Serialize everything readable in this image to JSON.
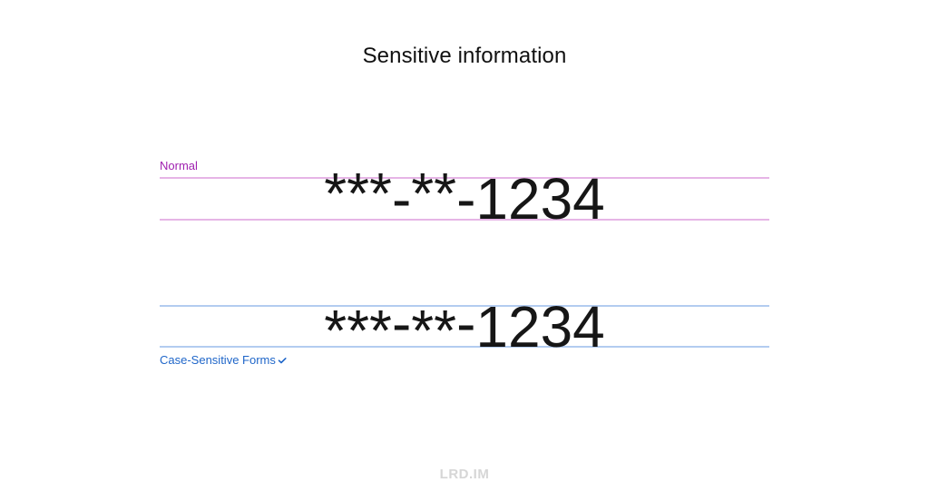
{
  "title": "Sensitive information",
  "rows": [
    {
      "label": "Normal",
      "color": "#a020b0",
      "guide_color": "#e6b5e6",
      "mask": "***",
      "sep1": "-",
      "mask2": "**",
      "sep2": "-",
      "digits": "1234"
    },
    {
      "label": "Case-Sensitive Forms",
      "color": "#1f66c9",
      "guide_color": "#b3ccf0",
      "enabled": true,
      "mask": "***",
      "sep1": "-",
      "mask2": "**",
      "sep2": "-",
      "digits": "1234"
    }
  ],
  "footer": "LRD.IM"
}
